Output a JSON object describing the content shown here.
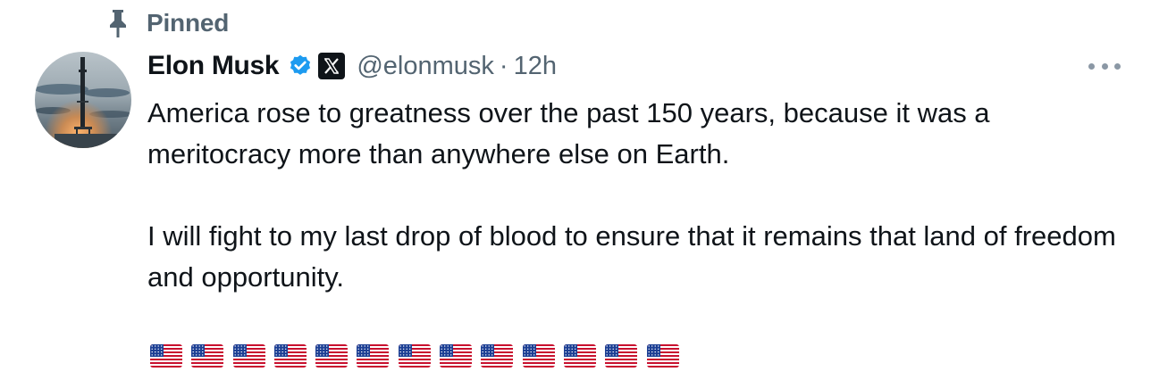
{
  "pinned": {
    "label": "Pinned",
    "icon": "pin-icon"
  },
  "author": {
    "display_name": "Elon Musk",
    "handle": "@elonmusk",
    "separator": "·",
    "timestamp": "12h",
    "verified_icon": "verified-badge-icon",
    "verified_color": "#1d9bf0",
    "affiliate_icon": "x-logo-icon",
    "avatar": "avatar"
  },
  "more_icon": "more-options-icon",
  "tweet": {
    "paragraphs": [
      "America rose to greatness over the past 150 years, because it was a meritocracy more than anywhere else on Earth.",
      "I will fight to my last drop of blood to ensure that it remains that land of freedom and opportunity."
    ],
    "flags": [
      "🇺🇸",
      "🇺🇸",
      "🇺🇸",
      "🇺🇸",
      "🇺🇸",
      "🇺🇸",
      "🇺🇸",
      "🇺🇸",
      "🇺🇸",
      "🇺🇸",
      "🇺🇸",
      "🇺🇸",
      "🇺🇸"
    ]
  },
  "colors": {
    "text_primary": "#0f1419",
    "text_secondary": "#536471",
    "accent": "#1d9bf0"
  }
}
